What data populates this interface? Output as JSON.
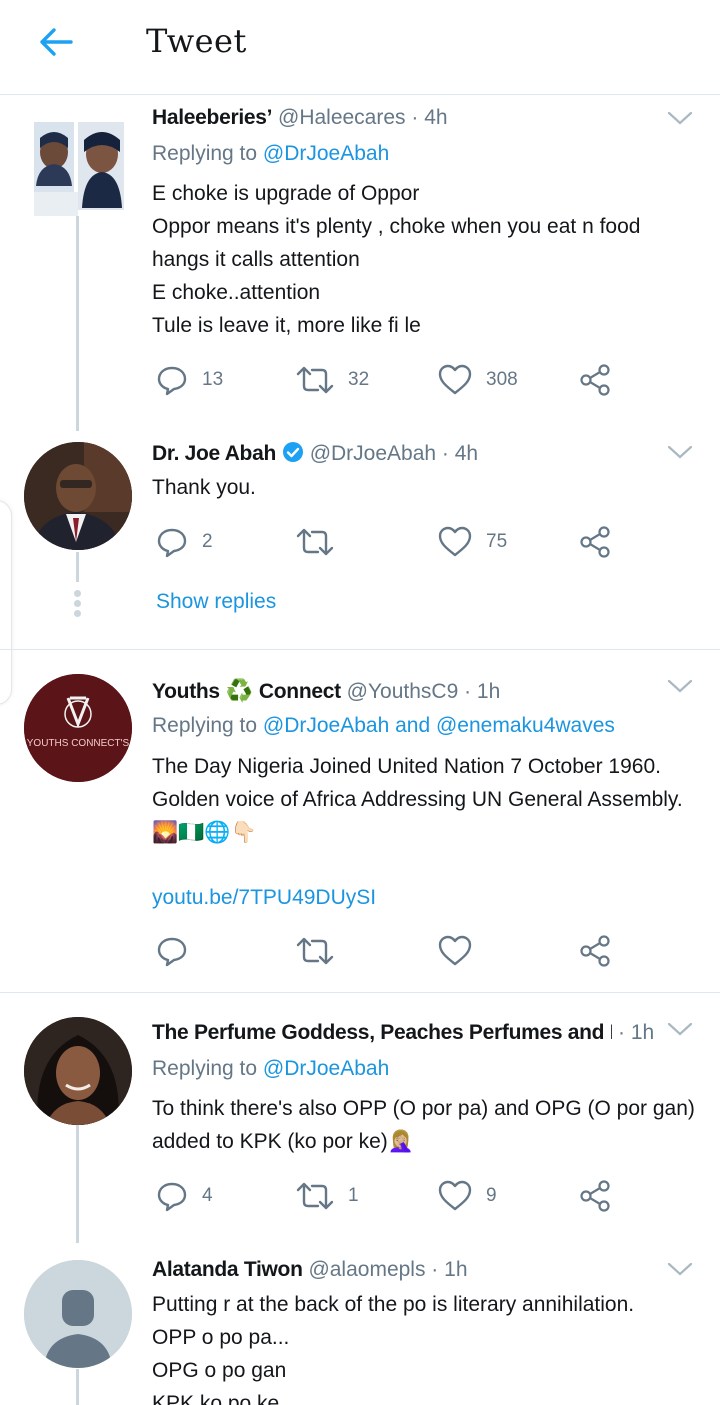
{
  "header": {
    "title": "Tweet"
  },
  "tweets": [
    {
      "name": "Haleeberies’",
      "handle": "@Haleecares · 4h",
      "replying_label": "Replying to",
      "replying_to": "@DrJoeAbah",
      "lines": [
        "E choke is upgrade of Oppor",
        "Oppor means it's plenty , choke when you eat n food",
        "hangs it calls attention",
        "E choke..attention",
        "Tule is leave it, more like fi le"
      ],
      "replies": "13",
      "retweets": "32",
      "likes": "308"
    },
    {
      "name": "Dr. Joe Abah",
      "handle": "@DrJoeAbah · 4h",
      "lines": [
        "Thank you."
      ],
      "replies": "2",
      "retweets": "",
      "likes": "75",
      "show_replies": "Show replies"
    },
    {
      "name_part1": "Youths",
      "name_part2": "Connect",
      "handle": "@YouthsC9 · 1h",
      "replying_label": "Replying to",
      "replying_to": "@DrJoeAbah and @enemaku4waves",
      "lines": [
        "The Day Nigeria Joined United Nation 7 October 1960.",
        "Golden voice of Africa Addressing UN General Assembly."
      ],
      "emoji_line": "🌄🇳🇬🌐👇🏻",
      "link": "youtu.be/7TPU49DUySI",
      "avatar_text": "YOUTHS CONNECT'S"
    },
    {
      "name": "The Perfume Goddess, Peaches Perfumes and P...",
      "handle": "· 1h",
      "replying_label": "Replying to",
      "replying_to": "@DrJoeAbah",
      "lines": [
        "To think there's also OPP (O por pa) and OPG (O por gan)",
        "added to KPK (ko por ke)🤦🏼‍♀️"
      ],
      "replies": "4",
      "retweets": "1",
      "likes": "9"
    },
    {
      "name": "Alatanda Tiwon",
      "handle": "@alaomepls · 1h",
      "lines": [
        "Putting r at the back of the po is literary annihilation.",
        "OPP o po pa...",
        "OPG o po gan",
        "KPK ko po ke..."
      ]
    }
  ],
  "colors": {
    "link": "#1b95e0",
    "muted": "#657786",
    "verified": "#1da1f2"
  }
}
